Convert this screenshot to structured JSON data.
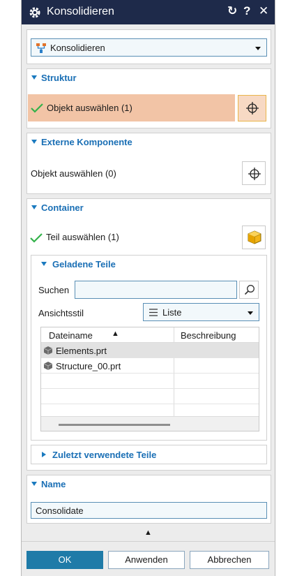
{
  "titlebar": {
    "title": "Konsolidieren",
    "reset_glyph": "↻",
    "help_glyph": "?",
    "close_glyph": "✕"
  },
  "type_select": {
    "value": "Konsolidieren"
  },
  "struktur": {
    "header": "Struktur",
    "select_label": "Objekt auswählen (1)",
    "highlight_color": "#f2c4a6"
  },
  "externe": {
    "header": "Externe Komponente",
    "select_label": "Objekt auswählen (0)"
  },
  "container": {
    "header": "Container",
    "select_label": "Teil auswählen (1)",
    "geladene": {
      "header": "Geladene Teile",
      "search_label": "Suchen",
      "search_value": "",
      "view_label": "Ansichtsstil",
      "view_value": "Liste",
      "table": {
        "columns": [
          "Dateiname",
          "Beschreibung"
        ],
        "sort_glyph": "▲",
        "rows": [
          {
            "name": "Elements.prt",
            "desc": ""
          },
          {
            "name": "Structure_00.prt",
            "desc": ""
          }
        ]
      }
    },
    "recent": {
      "header": "Zuletzt verwendete Teile"
    }
  },
  "name": {
    "header": "Name",
    "value": "Consolidate"
  },
  "collapse_glyph": "▲",
  "buttons": {
    "ok": "OK",
    "apply": "Anwenden",
    "cancel": "Abbrechen"
  },
  "colors": {
    "accent": "#1a6fb5",
    "titlebar": "#1e2a4a",
    "primary_button": "#1f7ba8",
    "check": "#33b24a"
  }
}
